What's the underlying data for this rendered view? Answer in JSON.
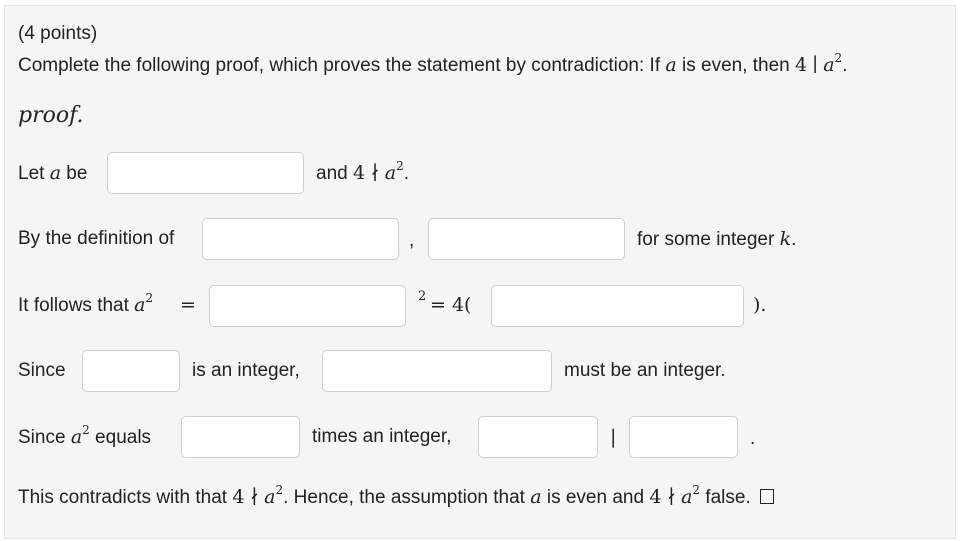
{
  "header": {
    "points": "(4 points)",
    "prompt_prefix": "Complete the following proof, which proves the statement by contradiction: If ",
    "prompt_var": "a",
    "prompt_middle": " is even, then ",
    "prompt_math_four": "4",
    "prompt_math_divides": "∣",
    "prompt_math_a": "a",
    "prompt_math_exp": "2",
    "prompt_end": "."
  },
  "proof_label": "proof.",
  "line1": {
    "prefix": "Let ",
    "var": "a",
    "mid": " be",
    "after_text": "and ",
    "four": "4",
    "ndiv": "∤",
    "a": "a",
    "exp": "2",
    "end": "."
  },
  "line2": {
    "text": "By the definition of",
    "comma": ",",
    "suffix": "for some integer ",
    "k": "k",
    "end": "."
  },
  "line3": {
    "prefix": "It follows that ",
    "a": "a",
    "exp": "2",
    "eq": "=",
    "sq_exp": "2",
    "eq2": "= 4(",
    "close": ")."
  },
  "line4": {
    "since": "Since",
    "is_int": "is an integer,",
    "must_be": "must be an integer."
  },
  "line5": {
    "since": "Since ",
    "a": "a",
    "exp": "2",
    "equals": " equals",
    "times": "times an integer,",
    "bar": "|",
    "end": "."
  },
  "line6": {
    "prefix": "This contradicts with that ",
    "four": "4",
    "ndiv": "∤",
    "a": "a",
    "exp": "2",
    "mid": ". Hence, the assumption that ",
    "a2": "a",
    "mid2": " is even and ",
    "four2": "4",
    "ndiv2": "∤",
    "a3": "a",
    "exp2": "2",
    "end": " false."
  }
}
